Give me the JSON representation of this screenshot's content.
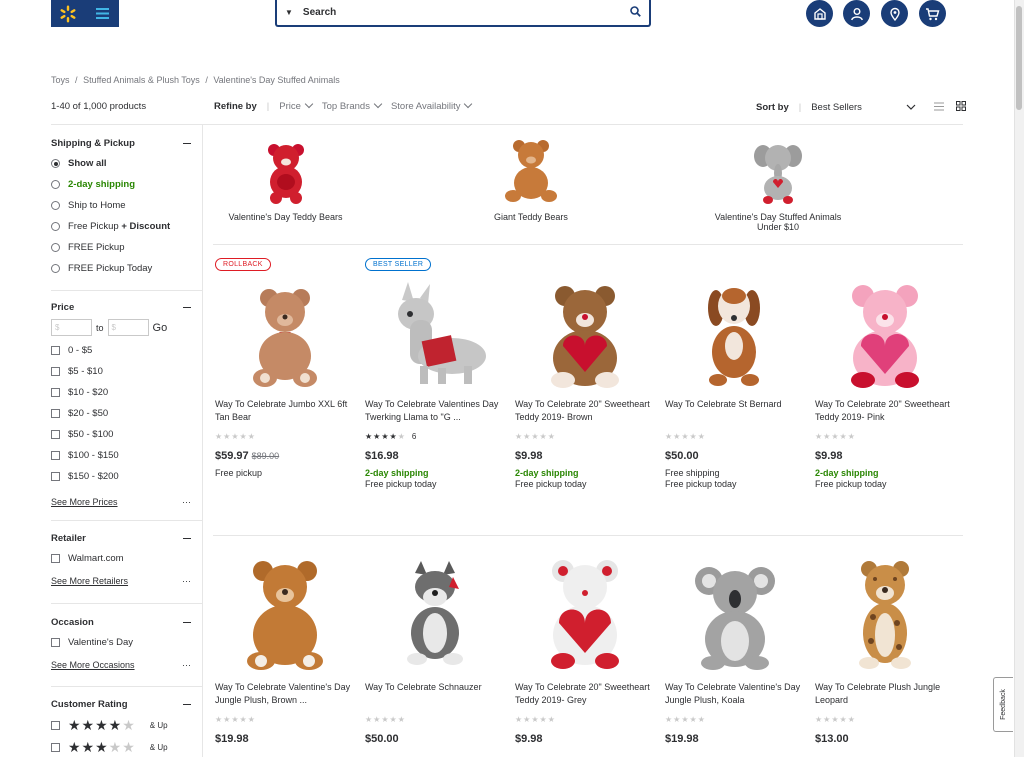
{
  "header": {
    "search_placeholder": "Search"
  },
  "breadcrumb": [
    "Toys",
    "/",
    "Stuffed Animals & Plush Toys",
    "/",
    "Valentine's Day Stuffed Animals"
  ],
  "results_count": "1-40 of 1,000 products",
  "refine": {
    "label": "Refine by",
    "filters": [
      "Price",
      "Top Brands",
      "Store Availability"
    ]
  },
  "sort": {
    "label": "Sort by",
    "value": "Best Sellers"
  },
  "sidebar": {
    "shipping": {
      "title": "Shipping & Pickup",
      "options": [
        {
          "label": "Show all",
          "bold": true,
          "selected": true
        },
        {
          "label": "2-day shipping",
          "green": true
        },
        {
          "label": "Ship to Home"
        },
        {
          "label_a": "Free Pickup",
          "label_b": "+ Discount"
        },
        {
          "label": "FREE Pickup"
        },
        {
          "label": "FREE Pickup Today"
        }
      ]
    },
    "price": {
      "title": "Price",
      "min_placeholder": "$",
      "to": "to",
      "max_placeholder": "$",
      "go": "Go",
      "ranges": [
        "0 - $5",
        "$5 - $10",
        "$10 - $20",
        "$20 - $50",
        "$50 - $100",
        "$100 - $150",
        "$150 - $200"
      ],
      "see_more": "See More Prices"
    },
    "retailer": {
      "title": "Retailer",
      "options": [
        "Walmart.com"
      ],
      "see_more": "See More Retailers"
    },
    "occasion": {
      "title": "Occasion",
      "options": [
        "Valentine's Day"
      ],
      "see_more": "See More Occasions"
    },
    "rating": {
      "title": "Customer Rating",
      "options": [
        {
          "stars": 4,
          "label": "& Up"
        },
        {
          "stars": 3,
          "label": "& Up"
        }
      ]
    }
  },
  "categories": [
    {
      "label": "Valentine's Day Teddy Bears"
    },
    {
      "label": "Giant Teddy Bears"
    },
    {
      "label_1": "Valentine's Day Stuffed Animals",
      "label_2": "Under $10"
    }
  ],
  "products": [
    {
      "badge": "ROLLBACK",
      "title": "Way To Celebrate Jumbo XXL 6ft Tan Bear",
      "price": "$59.97",
      "was": "$89.00",
      "ship": "Free pickup",
      "ship2": "",
      "rating": 0,
      "reviews": ""
    },
    {
      "badge": "BEST SELLER",
      "title": "Way To Celebrate Valentines Day Twerking Llama to \"G ...",
      "price": "$16.98",
      "was": "",
      "ship": "2-day shipping",
      "ship2": "Free pickup today",
      "rating": 4,
      "reviews": "6"
    },
    {
      "badge": "",
      "title": "Way To Celebrate 20\" Sweetheart Teddy 2019- Brown",
      "price": "$9.98",
      "was": "",
      "ship": "2-day shipping",
      "ship2": "Free pickup today",
      "rating": 0,
      "reviews": ""
    },
    {
      "badge": "",
      "title": "Way To Celebrate St Bernard",
      "price": "$50.00",
      "was": "",
      "ship": "Free shipping",
      "ship2": "Free pickup today",
      "rating": 0,
      "reviews": ""
    },
    {
      "badge": "",
      "title": "Way To Celebrate 20\" Sweetheart Teddy 2019- Pink",
      "price": "$9.98",
      "was": "",
      "ship": "2-day shipping",
      "ship2": "Free pickup today",
      "rating": 0,
      "reviews": ""
    },
    {
      "badge": "",
      "title": "Way To Celebrate Valentine's Day Jungle Plush, Brown ...",
      "price": "$19.98",
      "was": "",
      "ship": "",
      "ship2": "",
      "rating": 0,
      "reviews": ""
    },
    {
      "badge": "",
      "title": "Way To Celebrate Schnauzer",
      "price": "$50.00",
      "was": "",
      "ship": "",
      "ship2": "",
      "rating": 0,
      "reviews": ""
    },
    {
      "badge": "",
      "title": "Way To Celebrate 20\" Sweetheart Teddy 2019- Grey",
      "price": "$9.98",
      "was": "",
      "ship": "",
      "ship2": "",
      "rating": 0,
      "reviews": ""
    },
    {
      "badge": "",
      "title": "Way To Celebrate Valentine's Day Jungle Plush, Koala",
      "price": "$19.98",
      "was": "",
      "ship": "",
      "ship2": "",
      "rating": 0,
      "reviews": ""
    },
    {
      "badge": "",
      "title": "Way To Celebrate Plush Jungle Leopard",
      "price": "$13.00",
      "was": "",
      "ship": "",
      "ship2": "",
      "rating": 0,
      "reviews": ""
    }
  ],
  "feedback_label": "Feedback",
  "colors": {
    "brand": "#1a3d78",
    "spark": "#ffc220",
    "green": "#2a8703",
    "rollback": "#de1c24",
    "best_seller": "#0071ce"
  }
}
